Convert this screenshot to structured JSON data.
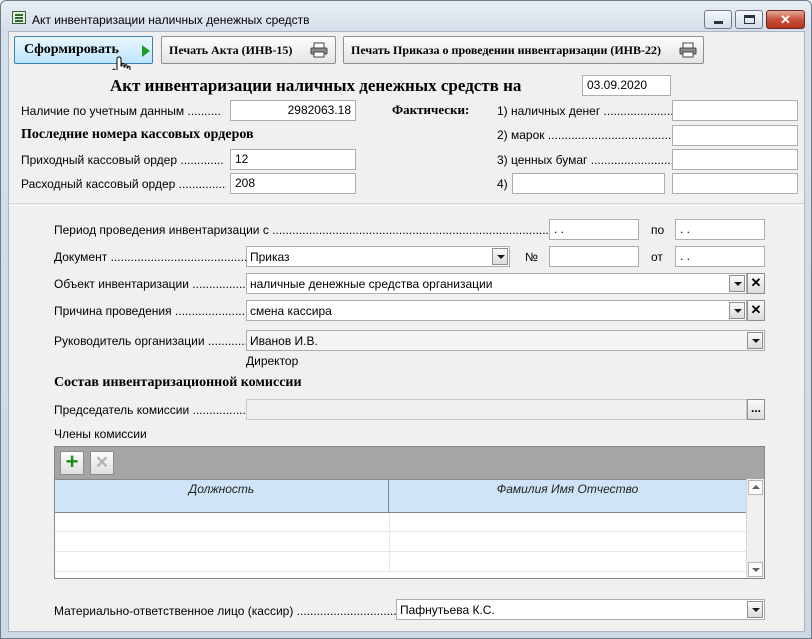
{
  "window": {
    "title": "Акт инвентаризации наличных денежных средств",
    "close_glyph": "✕"
  },
  "toolbar": {
    "form_label": "Сформировать",
    "print_act_label": "Печать Акта (ИНВ-15)",
    "print_order_label": "Печать Приказа о проведении инвентаризации (ИНВ-22)"
  },
  "header": {
    "title": "Акт инвентаризации наличных денежных средств на",
    "date": "03.09.2020",
    "balance_label": "Наличие по учетным данным ..........",
    "balance_value": "2982063.18",
    "actual_label": "Фактически:",
    "last_orders_heading": "Последние номера кассовых ордеров",
    "incoming_label": "Приходный кассовый ордер .............",
    "incoming_value": "12",
    "outgoing_label": "Расходный кассовый ордер ..............",
    "outgoing_value": "208",
    "actual_items": [
      {
        "label": "1) наличных денег ......................",
        "value": ""
      },
      {
        "label": "2) марок ..................................................",
        "value": ""
      },
      {
        "label": "3) ценных бумаг .......................................",
        "value": ""
      },
      {
        "label": "4)",
        "name_value": "",
        "value": ""
      }
    ]
  },
  "details": {
    "period_label": "Период проведения инвентаризации с .........................................................................................",
    "period_from": " .  .",
    "period_to_label": "по",
    "period_to": " .  .",
    "document_label": "Документ ................................................",
    "document_value": "Приказ",
    "number_label": "№",
    "number_value": "",
    "from_label": "от",
    "from_value": " .  .",
    "object_label": "Объект инвентаризации .....................",
    "object_value": "наличные денежные средства организации",
    "reason_label": "Причина проведения ...........................",
    "reason_value": "смена кассира",
    "head_label": "Руководитель организации .............",
    "head_value": "Иванов И.В.",
    "head_position": "Директор",
    "commission_heading": "Состав инвентаризационной комиссии",
    "chair_label": "Председатель комиссии ......................",
    "chair_value": "",
    "members_label": "Члены комиссии",
    "members_table": {
      "columns": [
        "Должность",
        "Фамилия Имя Отчество"
      ],
      "rows": [
        [
          "",
          ""
        ],
        [
          "",
          ""
        ],
        [
          "",
          ""
        ]
      ],
      "add_glyph": "+",
      "delete_glyph": "✕"
    },
    "cashier_label": "Материально-ответственное лицо (кассир) ..........................................",
    "cashier_value": "Пафнутьева К.С.",
    "clear_glyph": "✕",
    "dots_glyph": "..."
  }
}
